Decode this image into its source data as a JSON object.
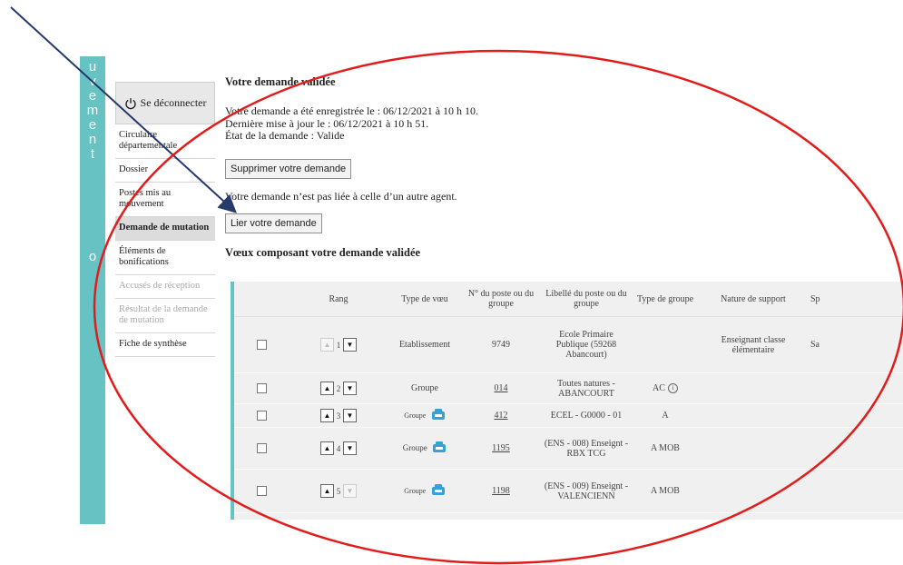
{
  "vertical_bar": {
    "letters": [
      "u",
      "v",
      "e",
      "m",
      "e",
      "n",
      "t"
    ],
    "bottom_letter": "o"
  },
  "sidebar": {
    "logout_label": "Se déconnecter",
    "items": [
      {
        "label": "Circulaire départementale"
      },
      {
        "label": "Dossier"
      },
      {
        "label": "Postes mis au mouvement"
      },
      {
        "label": "Demande de mutation"
      },
      {
        "label": "Éléments de bonifications"
      },
      {
        "label": "Accusés de réception"
      },
      {
        "label": "Résultat de la demande de mutation"
      },
      {
        "label": "Fiche de synthèse"
      }
    ]
  },
  "main": {
    "title": "Votre demande validée",
    "info_lines": [
      "Votre demande a été enregistrée le : 06/12/2021 à 10 h 10.",
      "Dernière mise à jour le : 06/12/2021 à 10 h 51.",
      "État de la demande : Valide"
    ],
    "delete_button": "Supprimer votre demande",
    "link_status": "Votre demande n’est pas liée à celle d’un autre agent.",
    "link_button": "Lier votre demande",
    "wishes_title": "Vœux composant votre demande validée"
  },
  "table": {
    "headers": [
      "Rang",
      "Type de vœu",
      "N° du poste ou du groupe",
      "Libellé du poste ou du groupe",
      "Type de groupe",
      "Nature de support",
      "Sp"
    ],
    "rows": [
      {
        "rank": "1",
        "type": "Etablissement",
        "number": "9749",
        "label": "Ecole Primaire Publique (59268 Abancourt)",
        "group_type": "",
        "support": "Enseignant classe élémentaire",
        "sp": "Sa"
      },
      {
        "rank": "2",
        "type": "Groupe",
        "number": "014",
        "label": "Toutes natures - ABANCOURT",
        "group_type": "AC",
        "support": "",
        "sp": ""
      },
      {
        "rank": "3",
        "type": "Groupe",
        "number": "412",
        "label": "ECEL - G0000 - 01",
        "group_type": "A",
        "support": "",
        "sp": ""
      },
      {
        "rank": "4",
        "type": "Groupe",
        "number": "1195",
        "label": "(ENS - 008) Enseignt - RBX TCG",
        "group_type": "A   MOB",
        "support": "",
        "sp": ""
      },
      {
        "rank": "5",
        "type": "Groupe",
        "number": "1198",
        "label": "(ENS - 009) Enseignt - VALENCIENN",
        "group_type": "A   MOB",
        "support": "",
        "sp": ""
      }
    ]
  },
  "annotation": {
    "arrow_color": "#263a6b",
    "ellipse_color": "#e21b1b"
  }
}
